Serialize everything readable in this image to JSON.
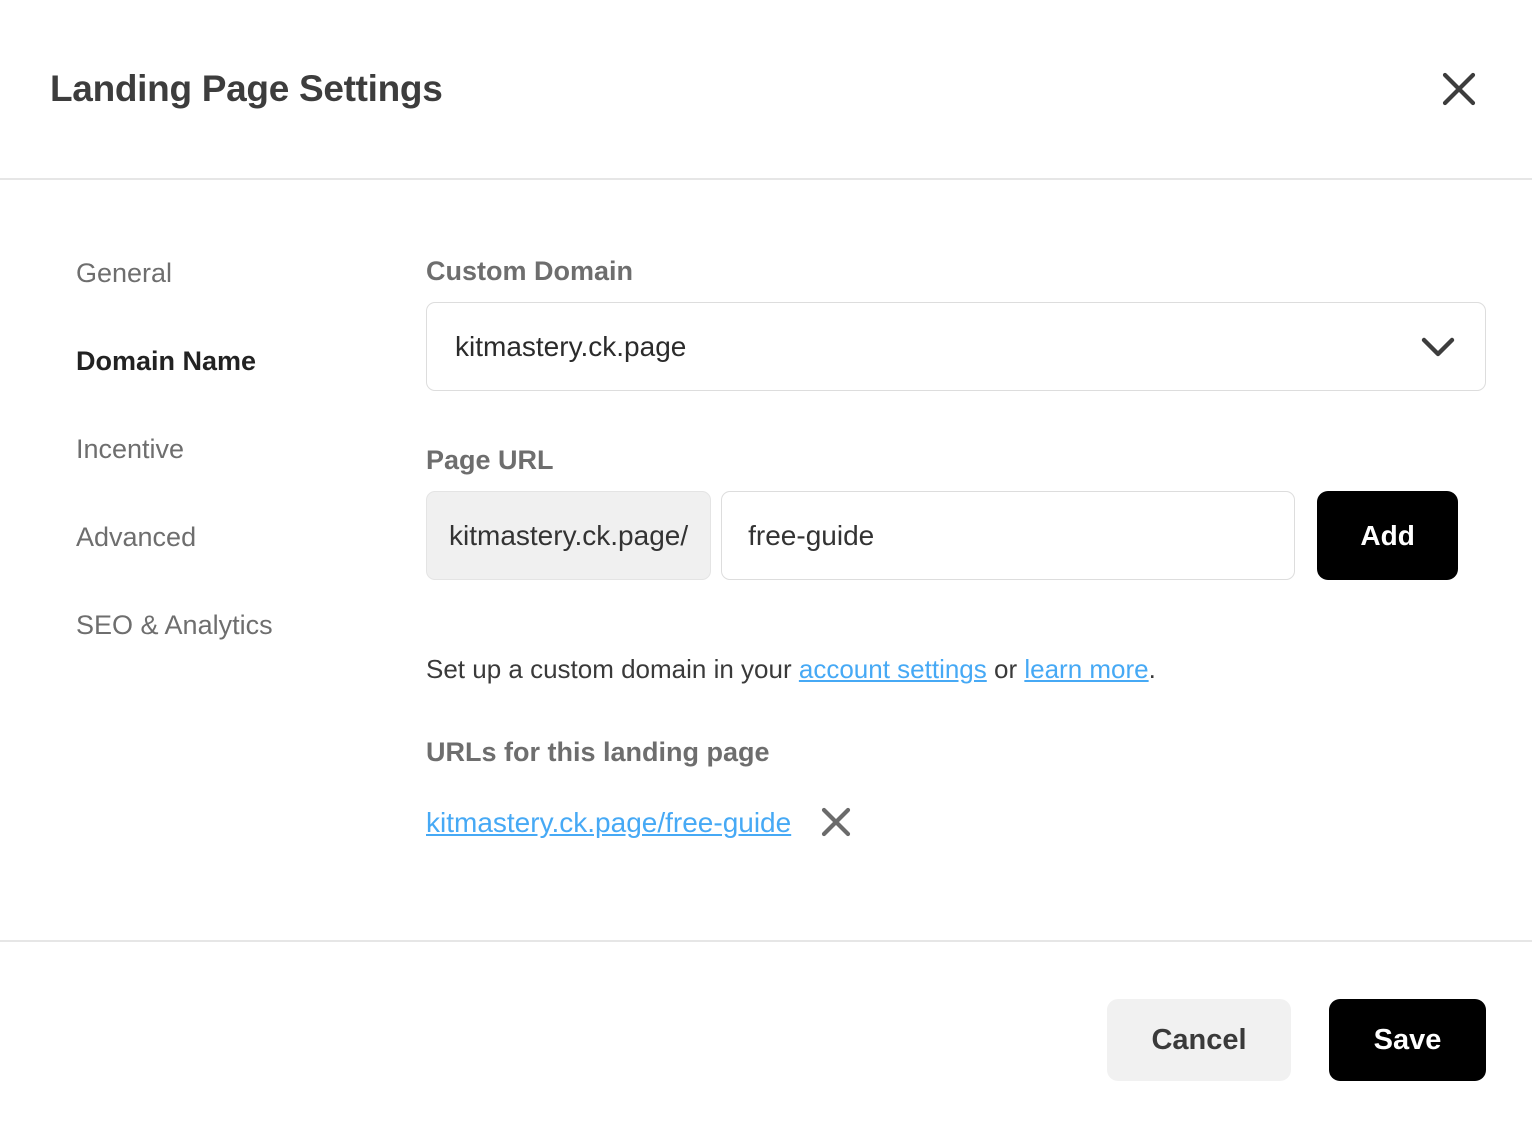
{
  "dialog": {
    "title": "Landing Page Settings",
    "close_icon": "close-icon"
  },
  "sidebar": {
    "items": [
      {
        "label": "General",
        "active": false
      },
      {
        "label": "Domain Name",
        "active": true
      },
      {
        "label": "Incentive",
        "active": false
      },
      {
        "label": "Advanced",
        "active": false
      },
      {
        "label": "SEO & Analytics",
        "active": false
      }
    ]
  },
  "main": {
    "custom_domain": {
      "label": "Custom Domain",
      "selected": "kitmastery.ck.page",
      "chevron_icon": "chevron-down-icon"
    },
    "page_url": {
      "label": "Page URL",
      "prefix": "kitmastery.ck.page/",
      "value": "free-guide",
      "placeholder": "free-guide",
      "add_label": "Add"
    },
    "helper": {
      "text_before": "Set up a custom domain in your ",
      "link_one": "account settings",
      "text_middle": " or ",
      "link_two": "learn more",
      "text_after": "."
    },
    "urls_section": {
      "heading": "URLs for this landing page",
      "items": [
        {
          "url": "kitmastery.ck.page/free-guide",
          "remove_icon": "close-icon"
        }
      ]
    }
  },
  "footer": {
    "cancel_label": "Cancel",
    "save_label": "Save"
  },
  "colors": {
    "link": "#46a9f5",
    "primary_button": "#000000",
    "secondary_button": "#f1f1f1",
    "text_muted": "#6e6e6e",
    "text_dark": "#222222",
    "border": "#dddddd"
  }
}
